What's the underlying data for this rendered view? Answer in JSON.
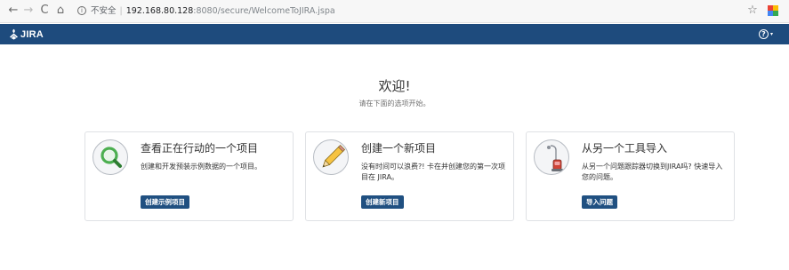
{
  "browser": {
    "back_icon": "←",
    "forward_icon": "→",
    "reload_icon": "C",
    "home_icon": "⌂",
    "info_icon": "i",
    "security_label": "不安全",
    "separator": "|",
    "url_host": "192.168.80.128",
    "url_rest": ":8080/secure/WelcomeToJIRA.jspa",
    "star_icon": "☆"
  },
  "header": {
    "logo_text": "JIRA",
    "help_icon": "?",
    "help_caret": "▾",
    "color": "#1e4b7d"
  },
  "welcome": {
    "title": "欢迎!",
    "subtitle": "请在下面的选项开始。"
  },
  "cards": [
    {
      "icon": "magnifier-icon",
      "title": "查看正在行动的一个项目",
      "description": "创建和开发预装示例数据的一个项目。",
      "button": "创建示例项目"
    },
    {
      "icon": "pencil-icon",
      "title": "创建一个新项目",
      "description": "没有时间可以浪费?! 卡在并创建您的第一次项目在 JIRA。",
      "button": "创建新项目"
    },
    {
      "icon": "vacuum-icon",
      "title": "从另一个工具导入",
      "description": "从另一个问题跟踪器切换到JIRA吗? 快速导入您的问题。",
      "button": "导入问题"
    }
  ],
  "colors": {
    "button": "#205081",
    "magnifier": "#4caf50",
    "pencil": "#f6c342",
    "vacuum": "#d04437"
  }
}
